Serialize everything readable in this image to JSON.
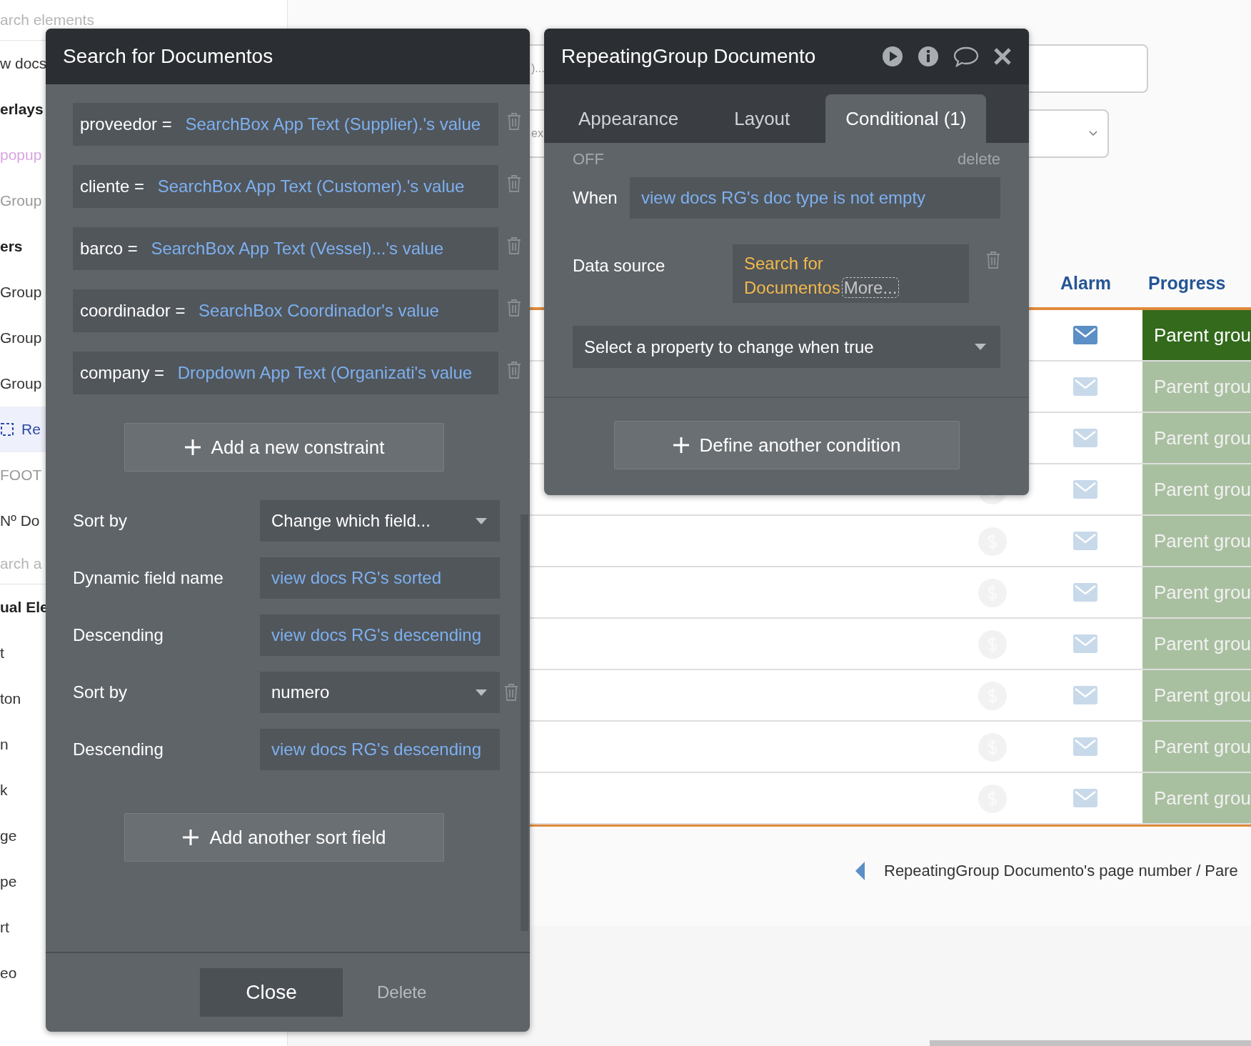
{
  "sidebar": {
    "items": [
      {
        "kind": "search",
        "text": "arch elements"
      },
      {
        "kind": "item",
        "text": "w docs"
      },
      {
        "kind": "header",
        "text": "erlays"
      },
      {
        "kind": "popup",
        "text": "popup"
      },
      {
        "kind": "muted",
        "text": "Group"
      },
      {
        "kind": "header",
        "text": "ers"
      },
      {
        "kind": "item",
        "text": "Group"
      },
      {
        "kind": "item",
        "text": "Group"
      },
      {
        "kind": "item",
        "text": "Group"
      },
      {
        "kind": "selected",
        "text": "Re"
      },
      {
        "kind": "muted",
        "text": "FOOT"
      },
      {
        "kind": "item",
        "text": "Nº Do"
      },
      {
        "kind": "search",
        "text": "arch a"
      },
      {
        "kind": "header",
        "text": "ual Ele"
      },
      {
        "kind": "item",
        "text": "t"
      },
      {
        "kind": "item",
        "text": "ton"
      },
      {
        "kind": "item",
        "text": "n"
      },
      {
        "kind": "item",
        "text": "k"
      },
      {
        "kind": "item",
        "text": "ge"
      },
      {
        "kind": "item",
        "text": "pe"
      },
      {
        "kind": "item",
        "text": "rt"
      },
      {
        "kind": "item",
        "text": "eo"
      }
    ]
  },
  "canvas": {
    "input_fragment": ")...",
    "dropdown_fragment": "ex",
    "table": {
      "columns": [
        "Alarm",
        "Progress"
      ],
      "rows": [
        {
          "active": true,
          "progress": "Parent grou"
        },
        {
          "active": false,
          "progress": "Parent grou"
        },
        {
          "active": false,
          "progress": "Parent grou"
        },
        {
          "active": false,
          "progress": "Parent grou"
        },
        {
          "active": false,
          "progress": "Parent grou"
        },
        {
          "active": false,
          "progress": "Parent grou"
        },
        {
          "active": false,
          "progress": "Parent grou"
        },
        {
          "active": false,
          "progress": "Parent grou"
        },
        {
          "active": false,
          "progress": "Parent grou"
        },
        {
          "active": false,
          "progress": "Parent grou"
        }
      ]
    },
    "pagination": "RepeatingGroup Documento's page number / Pare"
  },
  "search_panel": {
    "title": "Search for Documentos",
    "constraints": [
      {
        "field": "proveedor =",
        "value": "SearchBox App Text (Supplier).'s value"
      },
      {
        "field": "cliente =",
        "value": "SearchBox App Text (Customer).'s value"
      },
      {
        "field": "barco =",
        "value": "SearchBox App Text (Vessel)...'s value"
      },
      {
        "field": "coordinador =",
        "value": "SearchBox Coordinador's value"
      },
      {
        "field": "company =",
        "value": "Dropdown App Text (Organizati's value"
      }
    ],
    "add_constraint": "Add a new constraint",
    "sort_rows": [
      {
        "kind": "dropdown",
        "label": "Sort by",
        "value": "Change which field...",
        "deletable": false
      },
      {
        "kind": "expression",
        "label": "Dynamic field name",
        "value": "view docs RG's sorted",
        "deletable": false
      },
      {
        "kind": "expression",
        "label": "Descending",
        "value": "view docs RG's descending",
        "deletable": false
      },
      {
        "kind": "dropdown",
        "label": "Sort by",
        "value": "numero",
        "deletable": true
      },
      {
        "kind": "expression",
        "label": "Descending",
        "value": "view docs RG's descending",
        "deletable": false
      }
    ],
    "add_sort": "Add another sort field",
    "close": "Close",
    "delete": "Delete"
  },
  "rg_panel": {
    "title": "RepeatingGroup Documento",
    "tabs": [
      {
        "label": "Appearance",
        "selected": false
      },
      {
        "label": "Layout",
        "selected": false
      },
      {
        "label": "Conditional (1)",
        "selected": true
      }
    ],
    "condition": {
      "state": "OFF",
      "delete": "delete",
      "when_label": "When",
      "when": "view docs RG's doc type is not empty",
      "source_label": "Data source",
      "source": "Search for Documentos",
      "more": "More...",
      "property_placeholder": "Select a property to change when true"
    },
    "add_condition": "Define another condition"
  }
}
